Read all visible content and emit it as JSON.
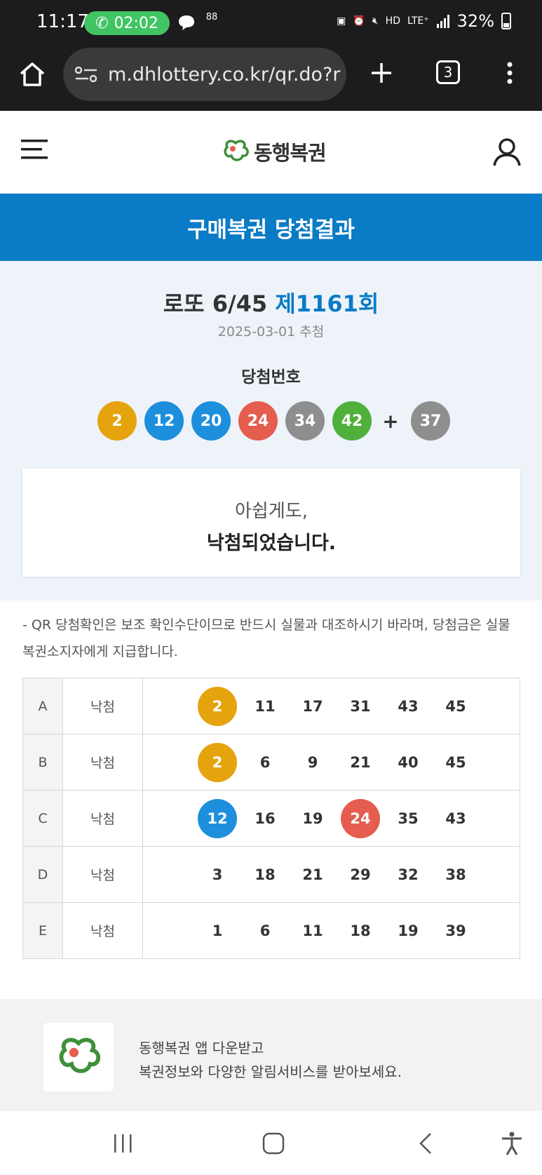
{
  "status_bar": {
    "time": "11:17",
    "call_timer": "02:02",
    "notif_glyph": "88",
    "hd_label": "HD",
    "lte_label": "LTE⁺",
    "battery": "32%"
  },
  "browser": {
    "url": "m.dhlottery.co.kr/qr.do?r",
    "tab_count": "3"
  },
  "header": {
    "logo_text": "동행복권"
  },
  "banner": {
    "title": "구매복권 당첨결과"
  },
  "result": {
    "game": "로또 6/45",
    "round": "제1161회",
    "draw_date": "2025-03-01 추첨",
    "winning_label": "당첨번호",
    "winning_numbers": [
      "2",
      "12",
      "20",
      "24",
      "34",
      "42"
    ],
    "plus": "+",
    "bonus_number": "37",
    "message_line1": "아쉽게도,",
    "message_line2": "낙첨되었습니다."
  },
  "notice": {
    "text": "- QR 당첨확인은 보조 확인수단이므로 반드시 실물과 대조하시기 바라며, 당첨금은 실물 복권소지자에게 지급합니다."
  },
  "tickets": [
    {
      "label": "A",
      "result": "낙첨",
      "numbers": [
        "2",
        "11",
        "17",
        "31",
        "43",
        "45"
      ]
    },
    {
      "label": "B",
      "result": "낙첨",
      "numbers": [
        "2",
        "6",
        "9",
        "21",
        "40",
        "45"
      ]
    },
    {
      "label": "C",
      "result": "낙첨",
      "numbers": [
        "12",
        "16",
        "19",
        "24",
        "35",
        "43"
      ]
    },
    {
      "label": "D",
      "result": "낙첨",
      "numbers": [
        "3",
        "18",
        "21",
        "29",
        "32",
        "38"
      ]
    },
    {
      "label": "E",
      "result": "낙첨",
      "numbers": [
        "1",
        "6",
        "11",
        "18",
        "19",
        "39"
      ]
    }
  ],
  "ball_colors": {
    "1-10": "#e5a40d",
    "11-20": "#1e8fdc",
    "21-30": "#e45d4f",
    "31-40": "#8e8e8e",
    "41-45": "#4fb03b"
  },
  "colors": {
    "banner": "#0a7bc6",
    "round_accent": "#0a7bc6",
    "result_bg": "#eef3f9",
    "logo_green": "#3f8f3a"
  },
  "promo": {
    "line1": "동행복권 앱 다운받고",
    "line2": "복권정보와 다양한 알림서비스를 받아보세요."
  },
  "icons": {
    "home": "home-icon",
    "site_settings": "tune-icon",
    "new_tab": "plus-icon",
    "tabs": "tab-switcher-icon",
    "overflow": "more-vert-icon",
    "menu": "hamburger-icon",
    "user": "user-icon",
    "recent_apps": "recent-apps-icon",
    "home_nav": "home-nav-icon",
    "back": "back-icon",
    "accessibility": "accessibility-icon"
  }
}
